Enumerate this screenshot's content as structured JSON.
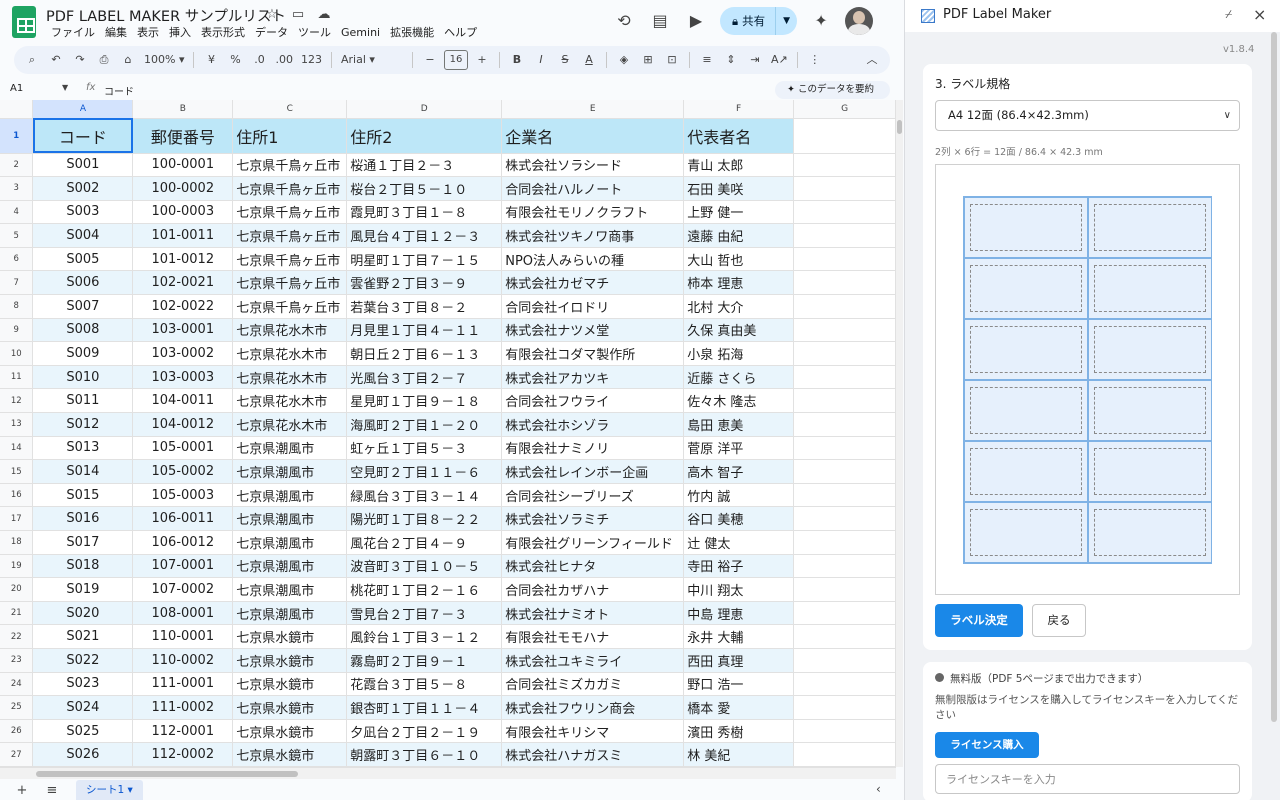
{
  "titlebar": {
    "doc_title": "PDF LABEL MAKER サンプルリスト",
    "menu": [
      "ファイル",
      "編集",
      "表示",
      "挿入",
      "表示形式",
      "データ",
      "ツール",
      "Gemini",
      "拡張機能",
      "ヘルプ"
    ],
    "share_label": "共有"
  },
  "toolbar": {
    "zoom": "100%",
    "currency": "¥",
    "percent": "%",
    "dec_decrease": ".0",
    "dec_increase": ".00",
    "format_123": "123",
    "font": "Arial",
    "font_size": "16"
  },
  "formulabar": {
    "cell_ref": "A1",
    "fx": "fx",
    "value": "コード",
    "summarize_label": "このデータを要約"
  },
  "grid": {
    "columns": [
      "A",
      "B",
      "C",
      "D",
      "E",
      "F",
      "G"
    ],
    "headers": [
      "コード",
      "郵便番号",
      "住所1",
      "住所2",
      "企業名",
      "代表者名"
    ],
    "rows": [
      [
        "S001",
        "100-0001",
        "七京県千鳥ヶ丘市",
        "桜通１丁目２－３",
        "株式会社ソラシード",
        "青山 太郎"
      ],
      [
        "S002",
        "100-0002",
        "七京県千鳥ヶ丘市",
        "桜台２丁目５－１０",
        "合同会社ハルノート",
        "石田 美咲"
      ],
      [
        "S003",
        "100-0003",
        "七京県千鳥ヶ丘市",
        "霞見町３丁目１－８",
        "有限会社モリノクラフト",
        "上野 健一"
      ],
      [
        "S004",
        "101-0011",
        "七京県千鳥ヶ丘市",
        "風見台４丁目１２－３",
        "株式会社ツキノワ商事",
        "遠藤 由紀"
      ],
      [
        "S005",
        "101-0012",
        "七京県千鳥ヶ丘市",
        "明星町１丁目７－１５",
        "NPO法人みらいの種",
        "大山 哲也"
      ],
      [
        "S006",
        "102-0021",
        "七京県千鳥ヶ丘市",
        "雲雀野２丁目３－９",
        "株式会社カゼマチ",
        "柿本 理恵"
      ],
      [
        "S007",
        "102-0022",
        "七京県千鳥ヶ丘市",
        "若葉台３丁目８－２",
        "合同会社イロドリ",
        "北村 大介"
      ],
      [
        "S008",
        "103-0001",
        "七京県花水木市",
        "月見里１丁目４－１１",
        "株式会社ナツメ堂",
        "久保 真由美"
      ],
      [
        "S009",
        "103-0002",
        "七京県花水木市",
        "朝日丘２丁目６－１３",
        "有限会社コダマ製作所",
        "小泉 拓海"
      ],
      [
        "S010",
        "103-0003",
        "七京県花水木市",
        "光風台３丁目２－７",
        "株式会社アカツキ",
        "近藤 さくら"
      ],
      [
        "S011",
        "104-0011",
        "七京県花水木市",
        "星見町１丁目９－１８",
        "合同会社フウライ",
        "佐々木 隆志"
      ],
      [
        "S012",
        "104-0012",
        "七京県花水木市",
        "海風町２丁目１－２０",
        "株式会社ホシゾラ",
        "島田 恵美"
      ],
      [
        "S013",
        "105-0001",
        "七京県潮風市",
        "虹ヶ丘１丁目５－３",
        "有限会社ナミノリ",
        "菅原 洋平"
      ],
      [
        "S014",
        "105-0002",
        "七京県潮風市",
        "空見町２丁目１１－６",
        "株式会社レインボー企画",
        "高木 智子"
      ],
      [
        "S015",
        "105-0003",
        "七京県潮風市",
        "緑風台３丁目３－１４",
        "合同会社シーブリーズ",
        "竹内 誠"
      ],
      [
        "S016",
        "106-0011",
        "七京県潮風市",
        "陽光町１丁目８－２２",
        "株式会社ソラミチ",
        "谷口 美穂"
      ],
      [
        "S017",
        "106-0012",
        "七京県潮風市",
        "風花台２丁目４－９",
        "有限会社グリーンフィールド",
        "辻 健太"
      ],
      [
        "S018",
        "107-0001",
        "七京県潮風市",
        "波音町３丁目１０－５",
        "株式会社ヒナタ",
        "寺田 裕子"
      ],
      [
        "S019",
        "107-0002",
        "七京県潮風市",
        "桃花町１丁目２－１６",
        "合同会社カザハナ",
        "中川 翔太"
      ],
      [
        "S020",
        "108-0001",
        "七京県潮風市",
        "雪見台２丁目７－３",
        "株式会社ナミオト",
        "中島 理恵"
      ],
      [
        "S021",
        "110-0001",
        "七京県水鏡市",
        "風鈴台１丁目３－１２",
        "有限会社モモハナ",
        "永井 大輔"
      ],
      [
        "S022",
        "110-0002",
        "七京県水鏡市",
        "霧島町２丁目９－１",
        "株式会社ユキミライ",
        "西田 真理"
      ],
      [
        "S023",
        "111-0001",
        "七京県水鏡市",
        "花霞台３丁目５－８",
        "合同会社ミズカガミ",
        "野口 浩一"
      ],
      [
        "S024",
        "111-0002",
        "七京県水鏡市",
        "銀杏町１丁目１１－４",
        "株式会社フウリン商会",
        "橋本 愛"
      ],
      [
        "S025",
        "112-0001",
        "七京県水鏡市",
        "夕凪台２丁目２－１９",
        "有限会社キリシマ",
        "濱田 秀樹"
      ],
      [
        "S026",
        "112-0002",
        "七京県水鏡市",
        "朝露町３丁目６－１０",
        "株式会社ハナガスミ",
        "林 美紀"
      ]
    ]
  },
  "sheets": {
    "tab_label": "シート1"
  },
  "panel": {
    "title": "PDF Label Maker",
    "version": "v1.8.4",
    "section_title": "3. ラベル規格",
    "selected_label": "A4 12面 (86.4×42.3mm)",
    "spec_text": "2列 × 6行 = 12面 / 86.4 × 42.3 mm",
    "label_grid": {
      "columns": 2,
      "rows": 6
    },
    "confirm_button": "ラベル決定",
    "back_button": "戻る",
    "free_text": "無料版（PDF 5ページまで出力できます）",
    "unlimited_text": "無制限版はライセンスを購入してライセンスキーを入力してください",
    "purchase_button": "ライセンス購入",
    "license_placeholder": "ライセンスキーを入力"
  },
  "colors": {
    "header_fill": "#bde7f8",
    "band_fill": "#e9f5fc",
    "accent_blue": "#1a88e8",
    "sheets_green": "#1ea362",
    "share_fill": "#c2e7ff"
  }
}
